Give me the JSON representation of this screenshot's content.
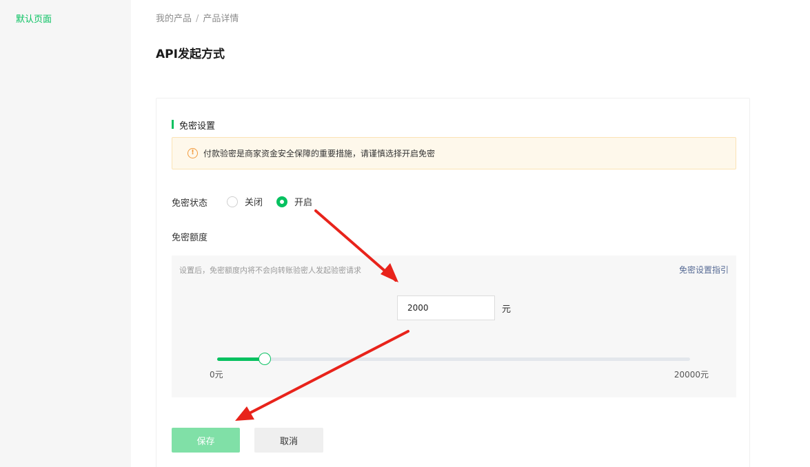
{
  "sidebar": {
    "items": [
      {
        "label": "默认页面"
      }
    ]
  },
  "breadcrumb": {
    "items": [
      "我的产品",
      "产品详情"
    ],
    "separator": "/"
  },
  "page": {
    "title": "API发起方式"
  },
  "section": {
    "title": "免密设置"
  },
  "notice": {
    "icon": "warning-icon",
    "text": "付款验密是商家资金安全保障的重要措施，请谨慎选择开启免密"
  },
  "form": {
    "status": {
      "label": "免密状态",
      "options": [
        {
          "label": "关闭",
          "checked": false
        },
        {
          "label": "开启",
          "checked": true
        }
      ]
    },
    "amount": {
      "label": "免密额度",
      "hint": "设置后，免密额度内将不会向转账验密人发起验密请求",
      "guide_link": "免密设置指引",
      "value": "2000",
      "unit": "元",
      "slider": {
        "min": 0,
        "max": 20000,
        "value": 2000,
        "min_label": "0元",
        "max_label": "20000元"
      }
    }
  },
  "actions": {
    "save_label": "保存",
    "cancel_label": "取消"
  },
  "colors": {
    "accent": "#07c160",
    "annotation": "#e8231b",
    "save_disabled": "#80e0a7",
    "link": "#576b95"
  }
}
